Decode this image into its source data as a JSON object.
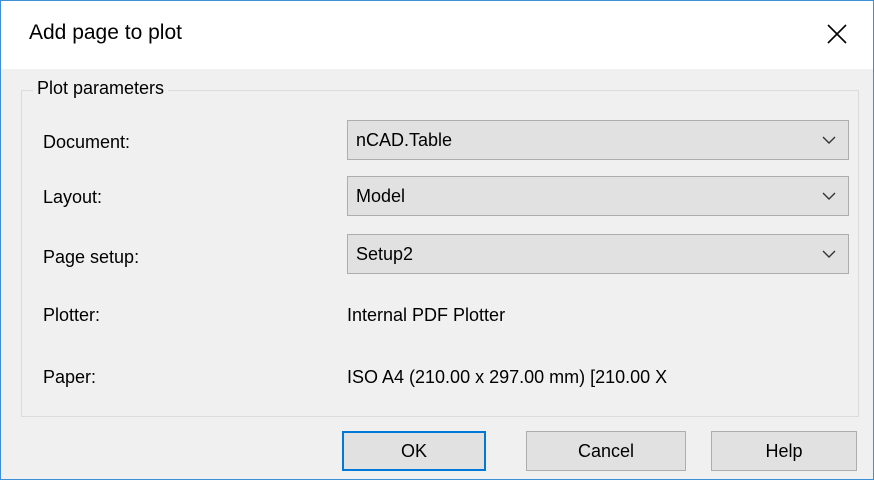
{
  "dialog": {
    "title": "Add page to plot",
    "close_icon": "close-icon"
  },
  "group": {
    "legend": "Plot parameters"
  },
  "fields": {
    "document": {
      "label": "Document:",
      "value": "nCAD.Table"
    },
    "layout": {
      "label": "Layout:",
      "value": "Model"
    },
    "page_setup": {
      "label": "Page setup:",
      "value": "Setup2"
    },
    "plotter": {
      "label": "Plotter:",
      "value": "Internal PDF Plotter"
    },
    "paper": {
      "label": "Paper:",
      "value": "ISO A4 (210.00 x 297.00 mm) [210.00 X"
    }
  },
  "buttons": {
    "ok": "OK",
    "cancel": "Cancel",
    "help": "Help"
  },
  "colors": {
    "accent": "#0078d7",
    "window_border": "#3f8fd8",
    "dialog_bg": "#f0f0f0",
    "control_bg": "#e1e1e1"
  }
}
